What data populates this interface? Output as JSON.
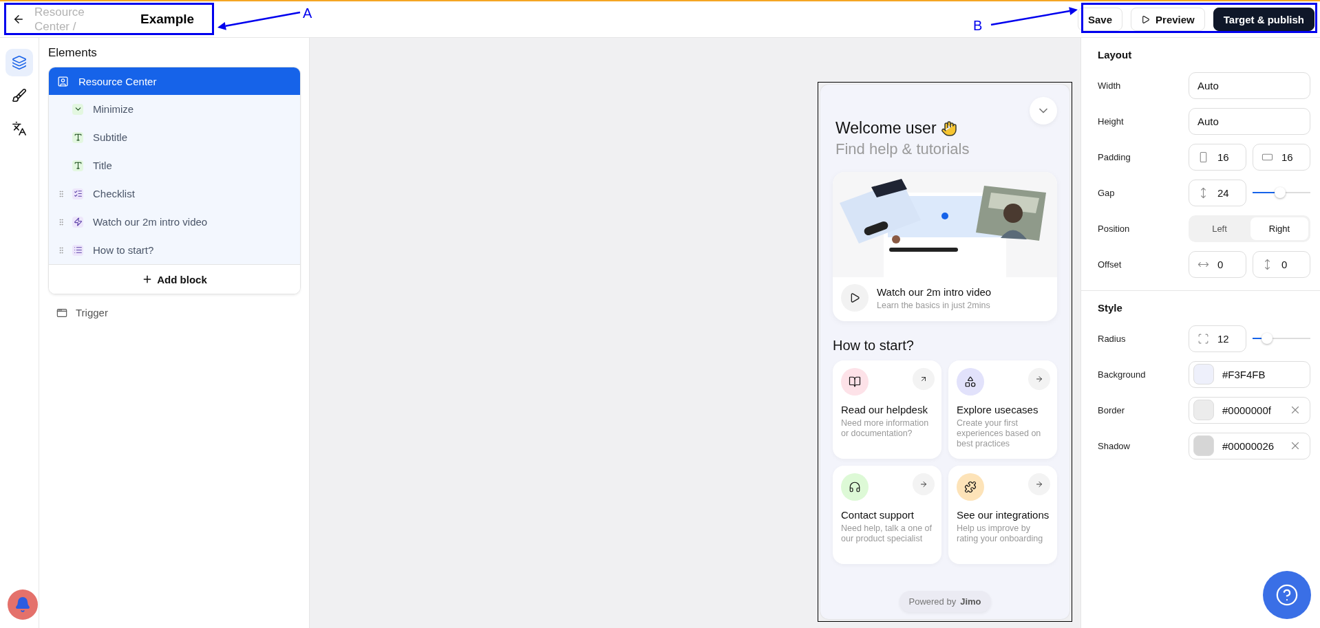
{
  "header": {
    "breadcrumb": "Resource Center /",
    "title": "Example",
    "buttons": [
      {
        "label": "Save",
        "kind": "secondary"
      },
      {
        "label": "Preview",
        "kind": "preview"
      },
      {
        "label": "Target & publish",
        "kind": "primary"
      }
    ]
  },
  "annotations": [
    {
      "label": "A",
      "kind": "left"
    },
    {
      "label": "B",
      "kind": "right"
    }
  ],
  "rail": [
    {
      "kind": "layers",
      "selected": true
    },
    {
      "kind": "brush",
      "selected": false
    },
    {
      "kind": "translate",
      "selected": false
    }
  ],
  "elements": {
    "heading": "Elements",
    "root": {
      "label": "Resource Center",
      "selected": true,
      "children": [
        {
          "label": "Minimize",
          "kind": "minimize",
          "draggable": false
        },
        {
          "label": "Subtitle",
          "kind": "text",
          "draggable": false
        },
        {
          "label": "Title",
          "kind": "text",
          "draggable": false
        },
        {
          "label": "Checklist",
          "kind": "checklist",
          "draggable": true
        },
        {
          "label": "Watch our 2m intro video",
          "kind": "video",
          "draggable": true
        },
        {
          "label": "How to start?",
          "kind": "list",
          "draggable": true
        }
      ]
    },
    "add_block": "Add block",
    "trigger": "Trigger"
  },
  "preview": {
    "title": "Welcome user",
    "subtitle": "Find help & tutorials",
    "video": {
      "kind": "picture",
      "title": "Watch our 2m intro video",
      "subtitle": "Learn the basics in just 2mins"
    },
    "section_title": "How to start?",
    "cards": [
      {
        "title": "Read our helpdesk",
        "description": "Need more information or documentation?",
        "color": "#fde2e8",
        "kind": "external"
      },
      {
        "title": "Explore usecases",
        "description": "Create your first experiences based on best practices",
        "color": "#e2e2fb",
        "kind": "next"
      },
      {
        "title": "Contact support",
        "description": "Need help, talk a one of our product specialist",
        "color": "#ddf9d6",
        "kind": "next"
      },
      {
        "title": "See our integrations",
        "description": "Help us improve by rating your onboarding",
        "color": "#fde3b8",
        "kind": "next"
      }
    ],
    "powered_by": "Powered by",
    "brand": "Jimo"
  },
  "settings": [
    {
      "title": "Layout",
      "rows": [
        {
          "label": "Width",
          "kind": "text",
          "value": "Auto"
        },
        {
          "label": "Height",
          "kind": "text",
          "value": "Auto"
        },
        {
          "label": "Padding",
          "kind": "pair",
          "fields": [
            {
              "kind": "horizontal",
              "value": "16"
            },
            {
              "kind": "vertical",
              "value": "16"
            }
          ]
        },
        {
          "label": "Gap",
          "kind": "slider",
          "field": {
            "kind": "gap",
            "value": "24"
          },
          "level": 0.48
        },
        {
          "label": "Position",
          "kind": "segmented",
          "options": [
            {
              "label": "Left",
              "selected": false
            },
            {
              "label": "Right",
              "selected": true
            }
          ]
        },
        {
          "label": "Offset",
          "kind": "pair",
          "fields": [
            {
              "kind": "x",
              "value": "0"
            },
            {
              "kind": "y",
              "value": "0"
            }
          ]
        }
      ]
    },
    {
      "title": "Style",
      "rows": [
        {
          "label": "Radius",
          "kind": "slider",
          "field": {
            "kind": "radius",
            "value": "12"
          },
          "level": 0.25
        },
        {
          "label": "Background",
          "kind": "color",
          "value": "#F3F4FB",
          "color": "#eef0fb",
          "clearable": false
        },
        {
          "label": "Border",
          "kind": "color",
          "value": "#0000000f",
          "color": "#ececec",
          "clearable": true
        },
        {
          "label": "Shadow",
          "kind": "color",
          "value": "#00000026",
          "color": "#d6d6d6",
          "clearable": true
        }
      ]
    }
  ]
}
